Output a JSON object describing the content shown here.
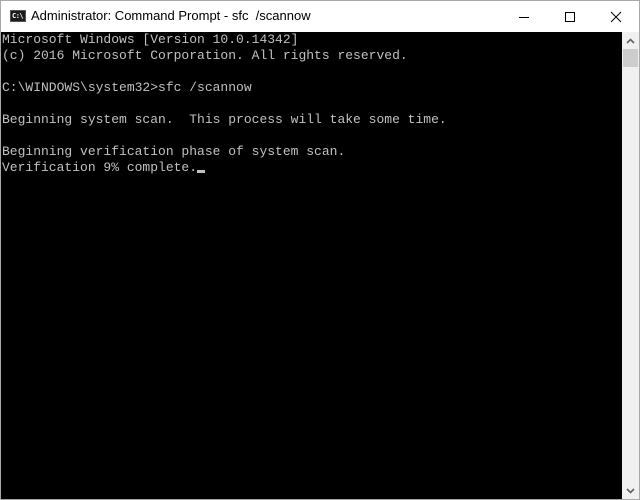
{
  "window": {
    "title": "Administrator: Command Prompt - sfc  /scannow",
    "app_icon_text": "C:\\",
    "controls": [
      "minimize",
      "maximize",
      "close"
    ]
  },
  "console": {
    "lines": [
      "Microsoft Windows [Version 10.0.14342]",
      "(c) 2016 Microsoft Corporation. All rights reserved.",
      "",
      "C:\\WINDOWS\\system32>sfc /scannow",
      "",
      "Beginning system scan.  This process will take some time.",
      "",
      "Beginning verification phase of system scan.",
      "Verification 9% complete."
    ],
    "progress_percent": 9,
    "colors": {
      "background": "#000000",
      "foreground": "#c0c0c0"
    }
  }
}
